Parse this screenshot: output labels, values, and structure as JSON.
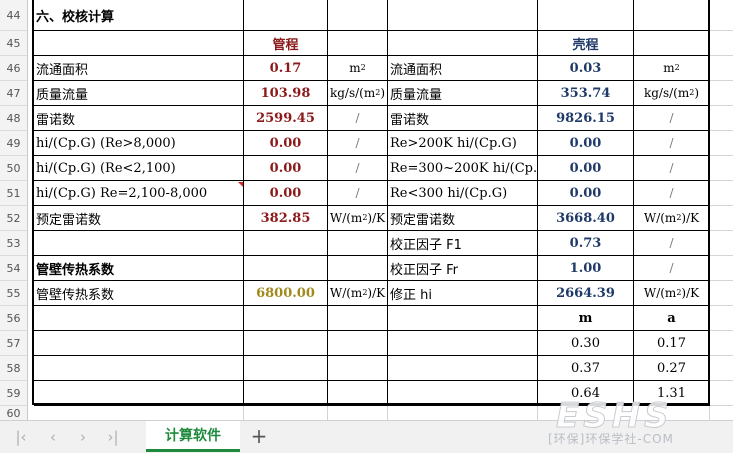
{
  "row_numbers": [
    "44",
    "45",
    "46",
    "47",
    "48",
    "49",
    "50",
    "51",
    "52",
    "53",
    "54",
    "55",
    "56",
    "57",
    "58",
    "59",
    "60"
  ],
  "section_title": "六、校核计算",
  "headers": {
    "tube_side": "管程",
    "shell_side": "壳程"
  },
  "rows": [
    {
      "left_label": "流通面积",
      "tube_value": "0.17",
      "tube_unit": "m",
      "tube_unit_sup": "2",
      "right_label": "流通面积",
      "shell_value": "0.03",
      "shell_unit": "m",
      "shell_unit_sup": "2"
    },
    {
      "left_label": "质量流量",
      "tube_value": "103.98",
      "tube_unit": "kg/s/(m",
      "tube_unit_sup": "2",
      "tube_unit_tail": ")",
      "right_label": "质量流量",
      "shell_value": "353.74",
      "shell_unit": "kg/s/(m",
      "shell_unit_sup": "2",
      "shell_unit_tail": ")"
    },
    {
      "left_label": "雷诺数",
      "tube_value": "2599.45",
      "tube_unit": "/",
      "right_label": "雷诺数",
      "shell_value": "9826.15",
      "shell_unit": "/"
    },
    {
      "left_label": "hi/(Cp.G) (Re>8,000)",
      "tube_value": "0.00",
      "tube_unit": "/",
      "right_label": "Re>200K hi/(Cp.G)",
      "shell_value": "0.00",
      "shell_unit": "/"
    },
    {
      "left_label": "hi/(Cp.G) (Re<2,100)",
      "tube_value": "0.00",
      "tube_unit": "/",
      "right_label": "Re=300~200K hi/(Cp.G)",
      "shell_value": "0.00",
      "shell_unit": "/"
    },
    {
      "left_label": "hi/(Cp.G) Re=2,100-8,000",
      "tube_value": "0.00",
      "tube_unit": "/",
      "right_label": "Re<300  hi/(Cp.G)",
      "shell_value": "0.00",
      "shell_unit": "/"
    },
    {
      "left_label": "预定雷诺数",
      "tube_value": "382.85",
      "tube_unit": "W/(m",
      "tube_unit_sup": "2",
      "tube_unit_tail": ")/K",
      "right_label": "预定雷诺数",
      "shell_value": "3668.40",
      "shell_unit": "W/(m",
      "shell_unit_sup": "2",
      "shell_unit_tail": ")/K"
    },
    {
      "right_label": "校正因子  F1",
      "shell_value": "0.73",
      "shell_unit": "/"
    },
    {
      "left_label": "管壁传热系数",
      "right_label": "校正因子  Fr",
      "shell_value": "1.00",
      "shell_unit": "/"
    },
    {
      "left_label": "管壁传热系数",
      "tube_value": "6800.00",
      "tube_unit": "W/(m",
      "tube_unit_sup": "2",
      "tube_unit_tail": ")/K",
      "right_label": "修正 hi",
      "shell_value": "2664.39",
      "shell_unit": "W/(m",
      "shell_unit_sup": "2",
      "shell_unit_tail": ")/K"
    }
  ],
  "ma_table": {
    "headers": [
      "m",
      "a"
    ],
    "rows": [
      [
        "0.30",
        "0.17"
      ],
      [
        "0.37",
        "0.27"
      ],
      [
        "0.64",
        "1.31"
      ]
    ]
  },
  "sheet_tabs": {
    "active": "计算软件",
    "add_label": "+"
  },
  "nav_glyphs": {
    "first": "|‹",
    "prev": "‹",
    "next": "›",
    "last": "›|"
  },
  "watermark": {
    "big": "ESHS",
    "small": "[环保]环保学社-COM"
  },
  "colors": {
    "tube_values": "#8b1a1a",
    "shell_values": "#1f3a68",
    "wall_coefficient": "#a08a1c",
    "active_tab": "#1e8a3c"
  }
}
